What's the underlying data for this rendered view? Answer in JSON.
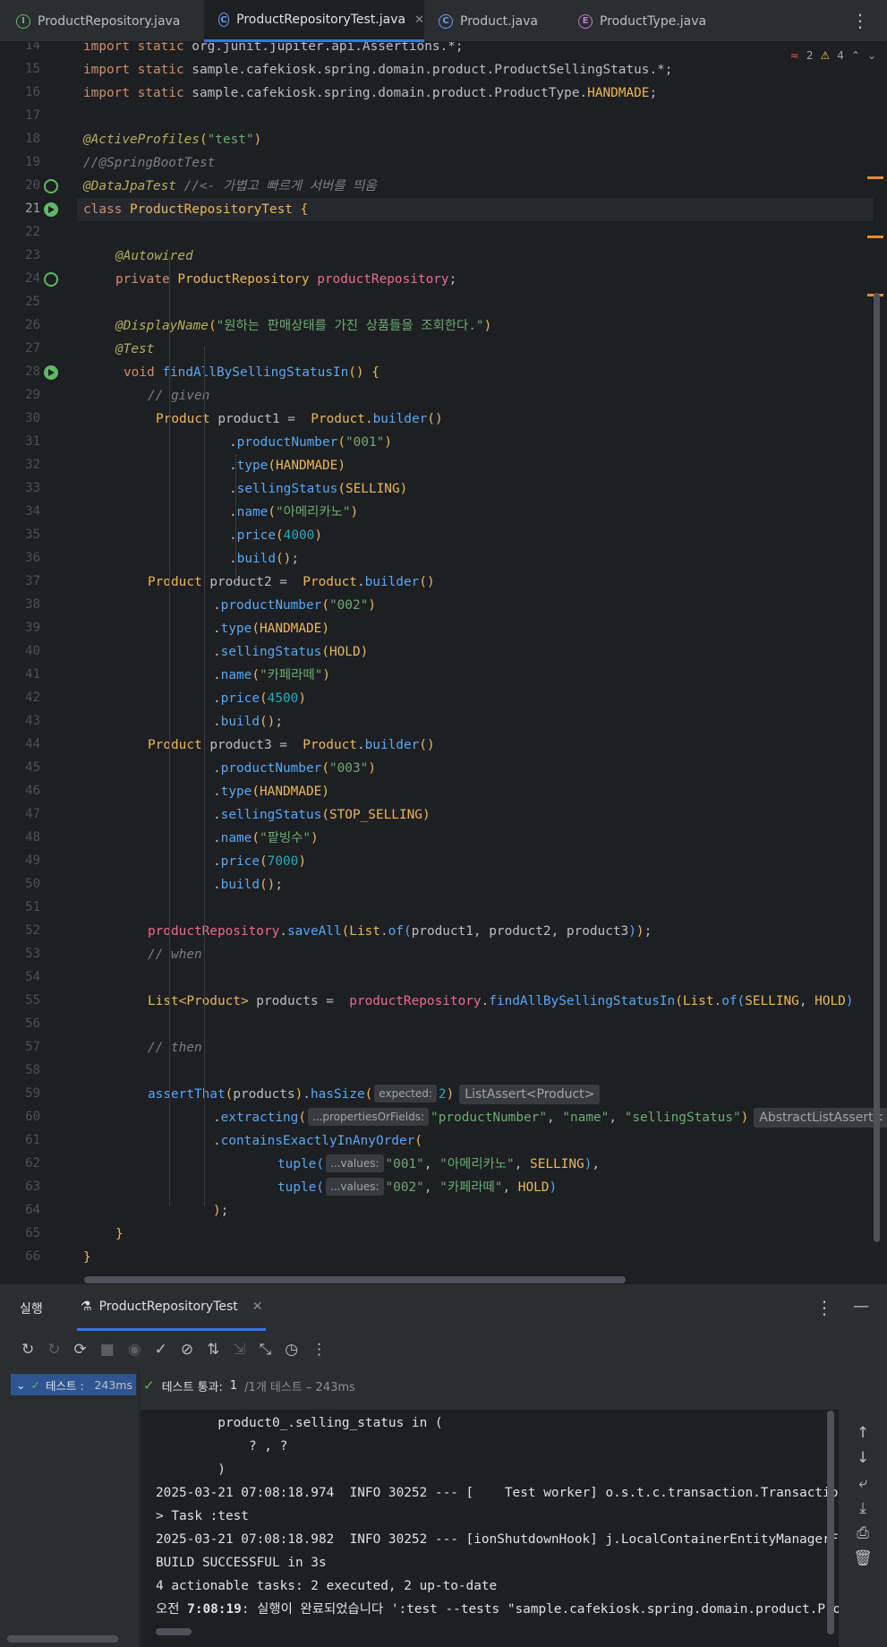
{
  "tabs": [
    {
      "label": "ProductRepository.java",
      "icon": "I",
      "icon_color": "#5fb865",
      "active": false
    },
    {
      "label": "ProductRepositoryTest.java",
      "icon": "C",
      "icon_color": "#6e9cf2",
      "active": true
    },
    {
      "label": "Product.java",
      "icon": "C",
      "icon_color": "#6e9cf2",
      "active": false
    },
    {
      "label": "ProductType.java",
      "icon": "E",
      "icon_color": "#b87fd9",
      "active": false
    }
  ],
  "inspections": {
    "errors": "2",
    "warnings": "4"
  },
  "code_lines": [
    {
      "n": "14",
      "t": "import static org.junit.jupiter.api.Assertions.*;"
    },
    {
      "n": "15",
      "t": "import static sample.cafekiosk.spring.domain.product.ProductSellingStatus.*;"
    },
    {
      "n": "16",
      "t": "import static sample.cafekiosk.spring.domain.product.ProductType.HANDMADE;"
    },
    {
      "n": "17",
      "t": ""
    },
    {
      "n": "18",
      "t": "@ActiveProfiles(\"test\")"
    },
    {
      "n": "19",
      "t": "//@SpringBootTest"
    },
    {
      "n": "20",
      "t": "@DataJpaTest //<- 가볍고 빠르게 서버를 띄움"
    },
    {
      "n": "21",
      "t": "class ProductRepositoryTest {"
    },
    {
      "n": "22",
      "t": ""
    },
    {
      "n": "23",
      "t": "@Autowired"
    },
    {
      "n": "24",
      "t": "private ProductRepository productRepository;"
    },
    {
      "n": "25",
      "t": ""
    },
    {
      "n": "26",
      "t": "@DisplayName(\"원하는 판매상태를 가진 상품들을 조회한다.\")"
    },
    {
      "n": "27",
      "t": "@Test"
    },
    {
      "n": "28",
      "t": "void findAllBySellingStatusIn() {"
    },
    {
      "n": "29",
      "t": "// given"
    },
    {
      "n": "30",
      "t": "Product product1 =  Product.builder()"
    },
    {
      "n": "31",
      "t": ".productNumber(\"001\")"
    },
    {
      "n": "32",
      "t": ".type(HANDMADE)"
    },
    {
      "n": "33",
      "t": ".sellingStatus(SELLING)"
    },
    {
      "n": "34",
      "t": ".name(\"아메리카노\")"
    },
    {
      "n": "35",
      "t": ".price(4000)"
    },
    {
      "n": "36",
      "t": ".build();"
    },
    {
      "n": "37",
      "t": "Product product2 =  Product.builder()"
    },
    {
      "n": "38",
      "t": ".productNumber(\"002\")"
    },
    {
      "n": "39",
      "t": ".type(HANDMADE)"
    },
    {
      "n": "40",
      "t": ".sellingStatus(HOLD)"
    },
    {
      "n": "41",
      "t": ".name(\"카페라떼\")"
    },
    {
      "n": "42",
      "t": ".price(4500)"
    },
    {
      "n": "43",
      "t": ".build();"
    },
    {
      "n": "44",
      "t": "Product product3 =  Product.builder()"
    },
    {
      "n": "45",
      "t": ".productNumber(\"003\")"
    },
    {
      "n": "46",
      "t": ".type(HANDMADE)"
    },
    {
      "n": "47",
      "t": ".sellingStatus(STOP_SELLING)"
    },
    {
      "n": "48",
      "t": ".name(\"팥빙수\")"
    },
    {
      "n": "49",
      "t": ".price(7000)"
    },
    {
      "n": "50",
      "t": ".build();"
    },
    {
      "n": "51",
      "t": ""
    },
    {
      "n": "52",
      "t": "productRepository.saveAll(List.of(product1, product2, product3));"
    },
    {
      "n": "53",
      "t": "// when"
    },
    {
      "n": "54",
      "t": ""
    },
    {
      "n": "55",
      "t": "List<Product> products =  productRepository.findAllBySellingStatusIn(List.of(SELLING, HOLD)"
    },
    {
      "n": "56",
      "t": ""
    },
    {
      "n": "57",
      "t": "// then"
    },
    {
      "n": "58",
      "t": ""
    },
    {
      "n": "59",
      "t": "assertThat(products).hasSize(expected: 2) ListAssert<Product>"
    },
    {
      "n": "60",
      "t": ".extracting(...propertiesOrFields: \"productNumber\", \"name\", \"sellingStatus\") AbstractListAssert<"
    },
    {
      "n": "61",
      "t": ".containsExactlyInAnyOrder("
    },
    {
      "n": "62",
      "t": "tuple(...values: \"001\", \"아메리카노\", SELLING),"
    },
    {
      "n": "63",
      "t": "tuple(...values: \"002\", \"카페라떼\", HOLD)"
    },
    {
      "n": "64",
      "t": ");"
    },
    {
      "n": "65",
      "t": "}"
    },
    {
      "n": "66",
      "t": "}"
    }
  ],
  "hints": {
    "expected": "expected:",
    "expected_val": "2",
    "list_assert": "ListAssert<Product>",
    "props": "...propertiesOrFields:",
    "abstract_assert": "AbstractListAssert<",
    "values": "...values:"
  },
  "run_panel": {
    "label": "실행",
    "tab": "ProductRepositoryTest",
    "tree_item": "테스트 :",
    "tree_time": "243ms",
    "status_pass": "테스트 통과:",
    "status_count": "1",
    "status_rest": "/1개 테스트 – 243ms",
    "console": [
      "        product0_.selling_status in (",
      "            ? , ?",
      "        )",
      "2025-03-21 07:08:18.974  INFO 30252 --- [    Test worker] o.s.t.c.transaction.TransactionContext",
      "> Task :test",
      "2025-03-21 07:08:18.982  INFO 30252 --- [ionShutdownHook] j.LocalContainerEntityManagerFactoryBean",
      "BUILD SUCCESSFUL in 3s",
      "4 actionable tasks: 2 executed, 2 up-to-date",
      "오전 7:08:19: 실행이 완료되었습니다 ':test --tests \"sample.cafekiosk.spring.domain.product.ProductRepositoryTest\"'"
    ]
  }
}
